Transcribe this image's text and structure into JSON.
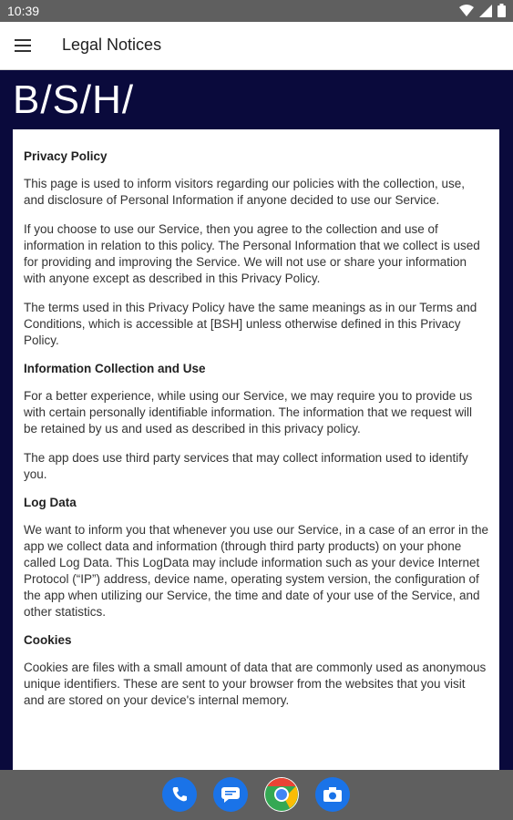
{
  "status": {
    "time": "10:39"
  },
  "appbar": {
    "title": "Legal Notices",
    "menu_icon": "hamburger-menu-icon"
  },
  "brand": {
    "logo_text": "B/S/H/"
  },
  "document": {
    "sections": [
      {
        "heading": "Privacy Policy",
        "paragraphs": [
          "This page is used to inform visitors regarding our policies with the collection, use, and disclosure of Personal Information if anyone decided to use our Service.",
          "If you choose to use our Service, then you agree to the collection and use of information in relation to this policy. The Personal Information that we collect is used for providing and improving the Service. We will not use or share your information with anyone except as described in this Privacy Policy.",
          "The terms used in this Privacy Policy have the same meanings as in our Terms and Conditions, which is accessible at [BSH] unless otherwise defined in this Privacy Policy."
        ]
      },
      {
        "heading": "Information Collection and Use",
        "paragraphs": [
          "For a better experience, while using our Service, we may require you to provide us with certain personally identifiable information. The information that we request will be retained by us and used as described in this privacy policy.",
          "The app does use third party services that may collect information used to identify you."
        ]
      },
      {
        "heading": "Log Data",
        "paragraphs": [
          "We want to inform you that whenever you use our Service, in a case of an error in the app we collect data and information (through third party products) on your phone called Log Data. This LogData may include information such as your device Internet Protocol (“IP”) address, device name, operating system version, the configuration of the app when utilizing our Service, the time and date of your use of the Service, and other statistics."
        ]
      },
      {
        "heading": "Cookies",
        "paragraphs": [
          "Cookies are files with a small amount of data that are commonly used as anonymous unique identifiers. These are sent to your browser from the websites that you visit and are stored on your device's internal memory."
        ]
      }
    ]
  },
  "dock": [
    {
      "name": "phone-icon",
      "color": "#1a73e8"
    },
    {
      "name": "messages-icon",
      "color": "#1a73e8"
    },
    {
      "name": "chrome-icon",
      "color": "#ea4335"
    },
    {
      "name": "camera-icon",
      "color": "#1a73e8"
    }
  ],
  "colors": {
    "brand_bg": "#0a0a3c",
    "system_bar": "#5f5f5f"
  }
}
